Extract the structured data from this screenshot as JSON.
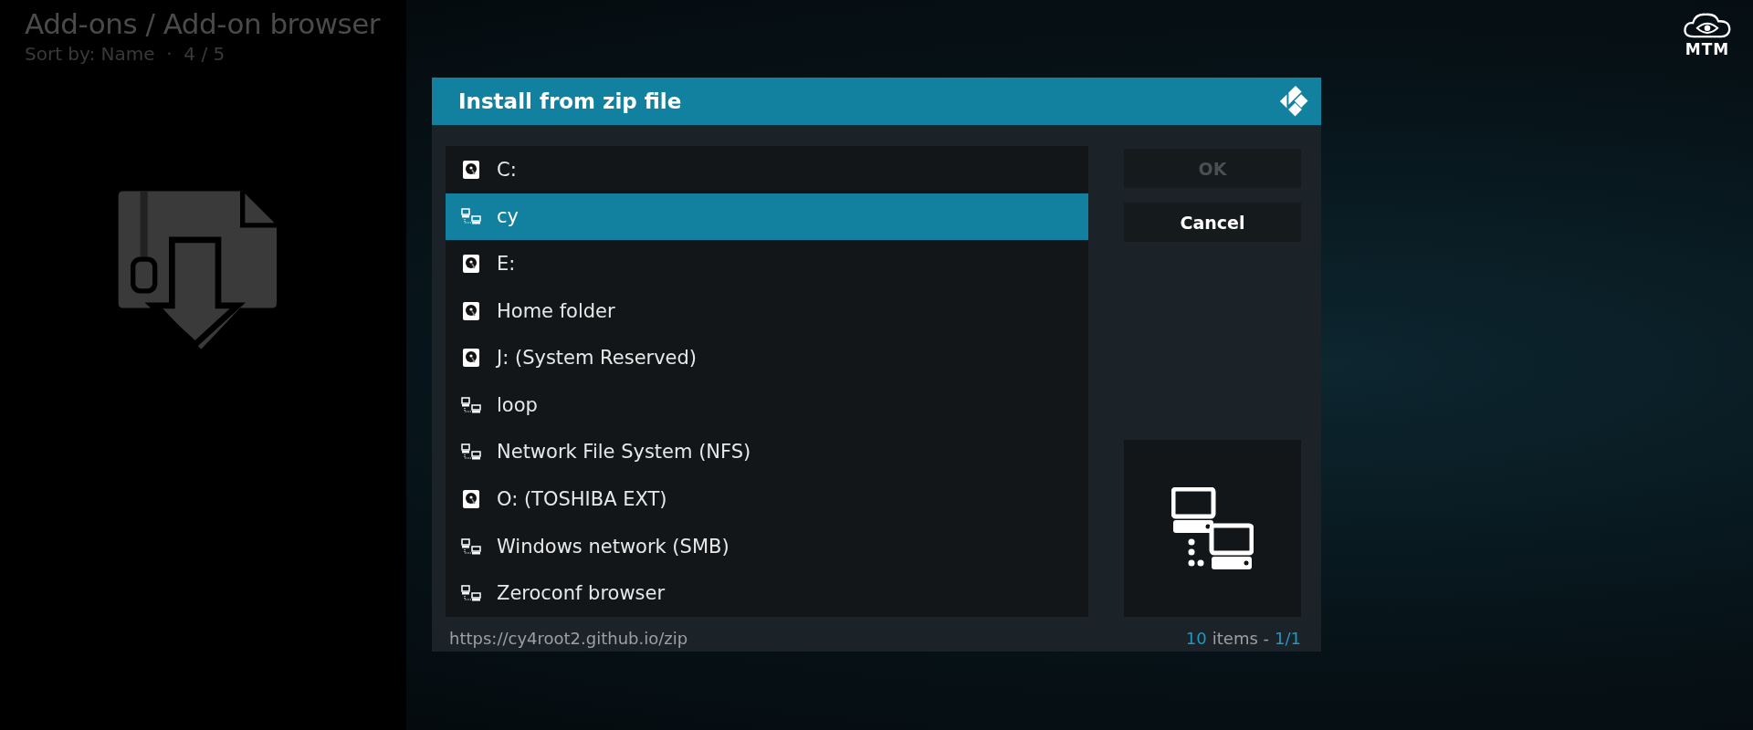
{
  "header": {
    "title": "Add-ons / Add-on browser",
    "subtitle": "Sort by: Name  ·  4 / 5"
  },
  "logo": {
    "label": "MTM"
  },
  "dialog": {
    "title": "Install from zip file",
    "items": [
      {
        "label": "C:",
        "kind": "drive",
        "selected": false
      },
      {
        "label": "cy",
        "kind": "network",
        "selected": true
      },
      {
        "label": "E:",
        "kind": "drive",
        "selected": false
      },
      {
        "label": "Home folder",
        "kind": "drive",
        "selected": false
      },
      {
        "label": "J: (System Reserved)",
        "kind": "drive",
        "selected": false
      },
      {
        "label": "loop",
        "kind": "network",
        "selected": false
      },
      {
        "label": "Network File System (NFS)",
        "kind": "network",
        "selected": false
      },
      {
        "label": "O: (TOSHIBA EXT)",
        "kind": "drive",
        "selected": false
      },
      {
        "label": "Windows network (SMB)",
        "kind": "network",
        "selected": false
      },
      {
        "label": "Zeroconf browser",
        "kind": "network",
        "selected": false
      }
    ],
    "buttons": [
      {
        "label": "OK",
        "disabled": true
      },
      {
        "label": "Cancel",
        "disabled": false
      }
    ],
    "preview": {
      "kind": "network"
    },
    "footer": {
      "path": "https://cy4root2.github.io/zip",
      "count": "10",
      "count_label": "items -",
      "page": "1/1"
    }
  }
}
